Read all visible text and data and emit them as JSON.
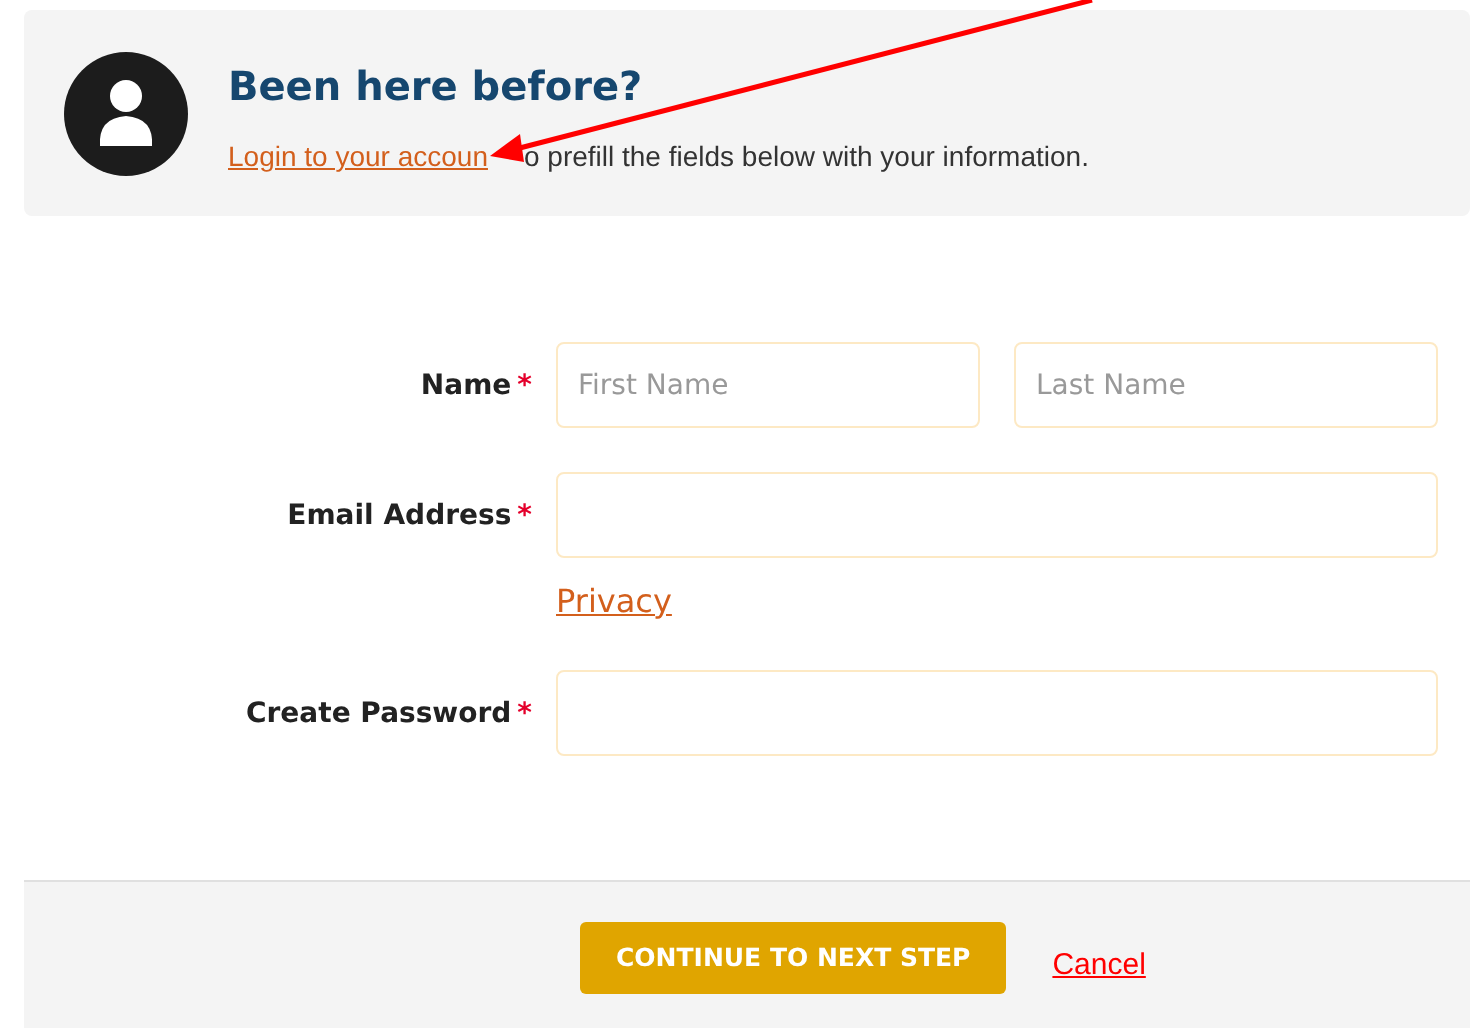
{
  "login_banner": {
    "title": "Been here before?",
    "link": "Login to your accoun",
    "text": "o prefill the fields below with your information."
  },
  "form": {
    "fields": [
      {
        "label": "Name",
        "required_mark": "*",
        "kind": "name",
        "inputs": [
          {
            "placeholder": "First Name"
          },
          {
            "placeholder": "Last Name"
          }
        ]
      },
      {
        "label": "Email Address",
        "required_mark": "*",
        "kind": "single",
        "link": "Privacy"
      },
      {
        "label": "Create Password",
        "required_mark": "*",
        "kind": "single"
      }
    ]
  },
  "footer": {
    "primary_button": "CONTINUE TO NEXT STEP",
    "cancel_link": "Cancel"
  }
}
